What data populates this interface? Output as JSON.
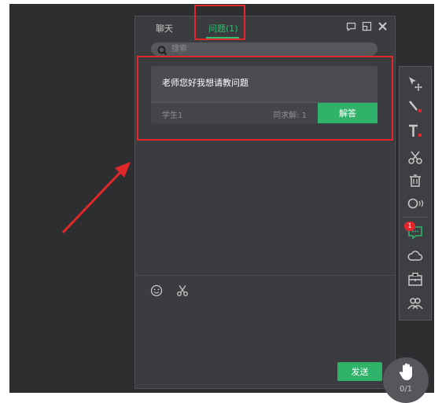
{
  "tabs": {
    "chat_label": "聊天",
    "question_label": "问题(1)"
  },
  "search": {
    "placeholder": "搜索"
  },
  "question": {
    "text": "老师您好我想请教问题",
    "student": "学生1",
    "same_question": "同求解: 1",
    "answer_label": "解答"
  },
  "composer": {
    "send_label": "发送"
  },
  "toolbar": {
    "icons": [
      "select-icon",
      "pen-icon",
      "text-icon",
      "scissors-icon",
      "trash-icon",
      "laser-icon",
      "questions-icon",
      "cloud-icon",
      "toolbox-icon",
      "users-icon"
    ],
    "questions_badge": "1"
  },
  "hand_raise": {
    "count": "0/1"
  },
  "colors": {
    "accent": "#2fb36b",
    "highlight": "#e2272b",
    "panel": "#3b3c40",
    "background": "#2d2e30"
  }
}
